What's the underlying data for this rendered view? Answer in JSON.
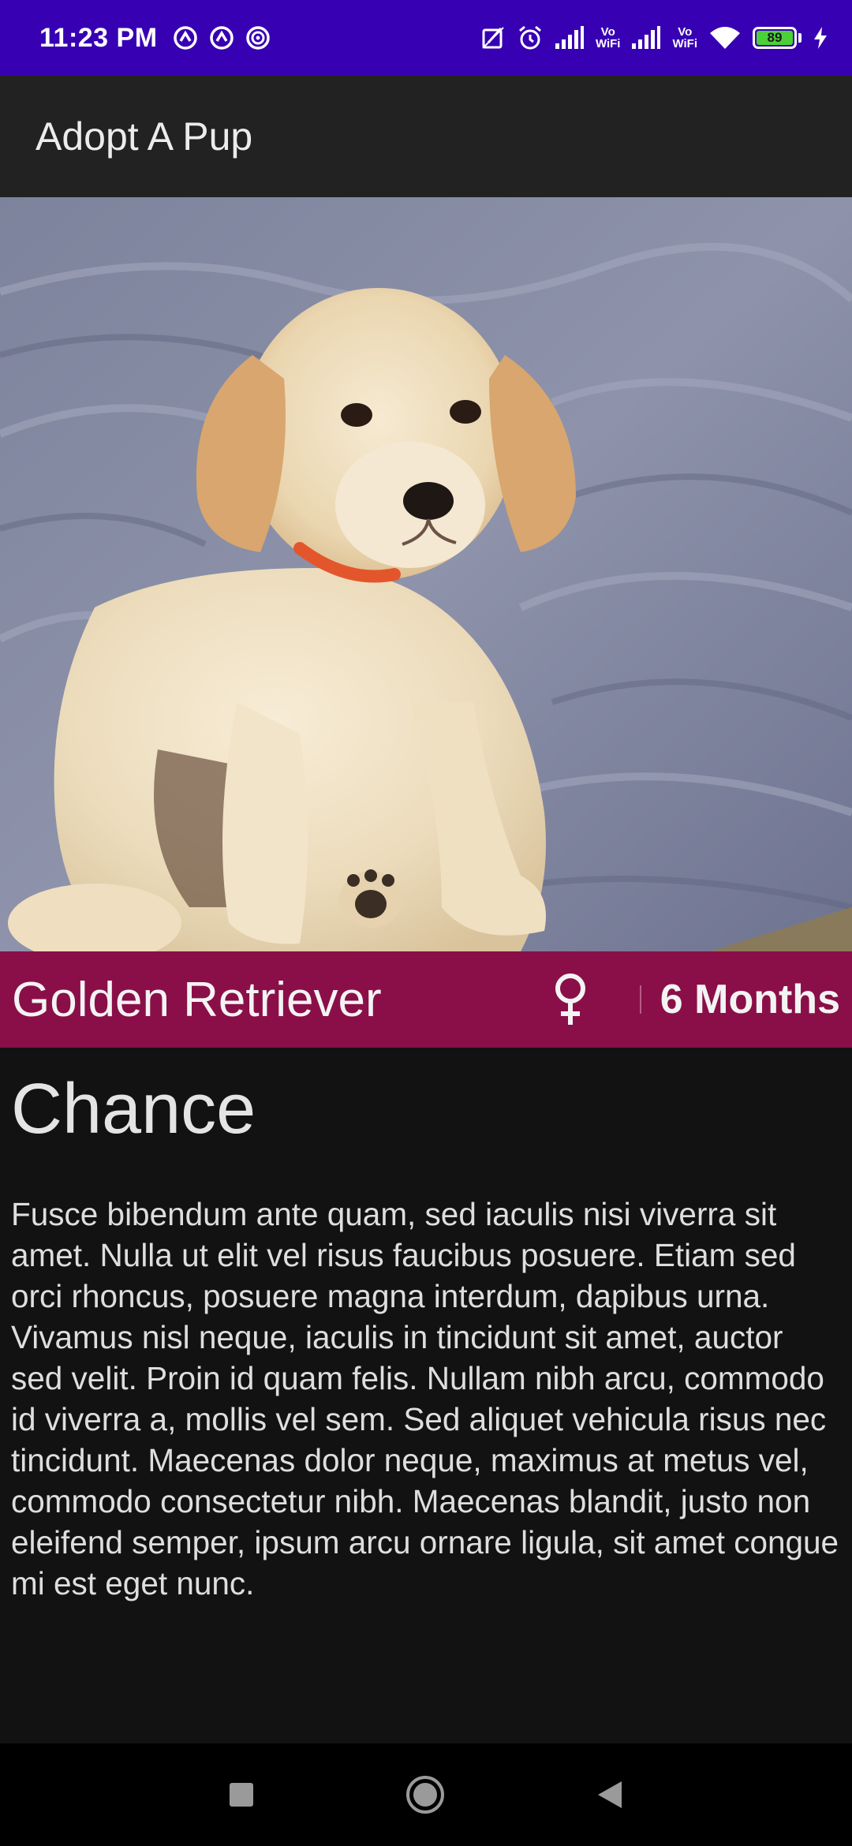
{
  "status_bar": {
    "time": "11:23 PM",
    "left_icons": [
      "notification-icon",
      "notification-icon",
      "radio-icon"
    ],
    "right_icons": [
      "edit-off-icon",
      "alarm-icon",
      "signal-icon",
      "vowifi-icon",
      "signal-icon",
      "vowifi-icon",
      "wifi-icon",
      "battery-icon",
      "charging-icon"
    ],
    "vowifi_top": "Vo",
    "vowifi_bottom": "WiFi",
    "battery_level": "89",
    "background_color": "#3700b3"
  },
  "app_bar": {
    "title": "Adopt A Pup"
  },
  "hero": {
    "image_icon": "puppy-photo"
  },
  "info_strip": {
    "breed": "Golden Retriever",
    "gender_icon": "female-icon",
    "age": "6 Months",
    "background_color": "#8a0f48"
  },
  "pet": {
    "name": "Chance",
    "description": "Fusce bibendum ante quam, sed iaculis nisi viverra sit amet. Nulla ut elit vel risus faucibus posuere. Etiam sed orci rhoncus, posuere magna interdum, dapibus urna. Vivamus nisl neque, iaculis in tincidunt sit amet, auctor sed velit. Proin id quam felis. Nullam nibh arcu, commodo id viverra a, mollis vel sem. Sed aliquet vehicula risus nec tincidunt. Maecenas dolor neque, maximus at metus vel, commodo consectetur nibh. Maecenas blandit, justo non eleifend semper, ipsum arcu ornare ligula, sit amet congue mi est eget nunc."
  },
  "nav_bar": {
    "buttons": [
      "recents-icon",
      "home-icon",
      "back-icon"
    ]
  }
}
